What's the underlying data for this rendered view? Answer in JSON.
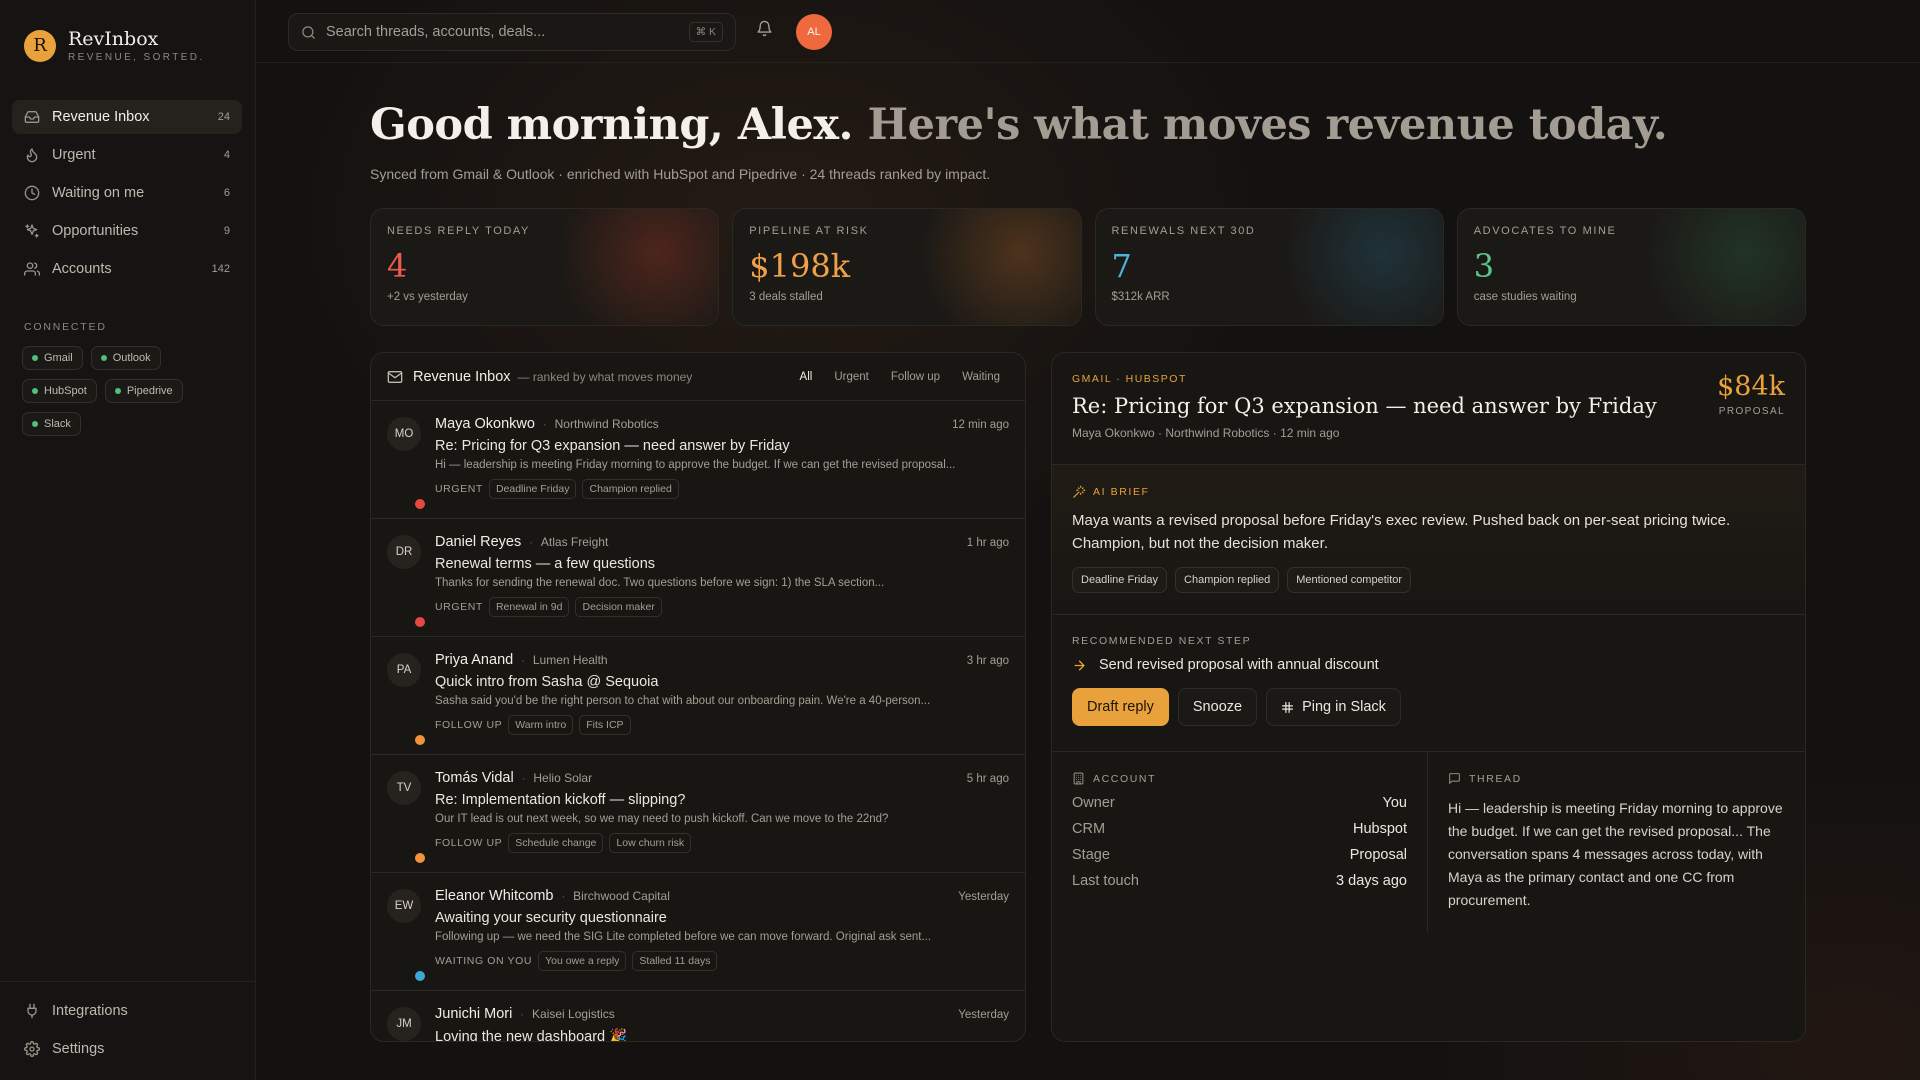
{
  "brand": {
    "logo_letter": "R",
    "name": "RevInbox",
    "tagline": "REVENUE, SORTED."
  },
  "sidebar": {
    "items": [
      {
        "label": "Revenue Inbox",
        "count": "24",
        "icon": "inbox-icon"
      },
      {
        "label": "Urgent",
        "count": "4",
        "icon": "flame-icon"
      },
      {
        "label": "Waiting on me",
        "count": "6",
        "icon": "clock-icon"
      },
      {
        "label": "Opportunities",
        "count": "9",
        "icon": "sparkles-icon"
      },
      {
        "label": "Accounts",
        "count": "142",
        "icon": "users-icon"
      }
    ],
    "connected_title": "CONNECTED",
    "connections": [
      "Gmail",
      "Outlook",
      "HubSpot",
      "Pipedrive",
      "Slack"
    ],
    "bottom": [
      {
        "label": "Integrations",
        "icon": "plug-icon"
      },
      {
        "label": "Settings",
        "icon": "gear-icon"
      }
    ]
  },
  "topbar": {
    "search_placeholder": "Search threads, accounts, deals...",
    "search_shortcut": "⌘ K",
    "avatar_initials": "AL"
  },
  "header": {
    "greeting": "Good morning, Alex.",
    "greeting_muted": "Here's what moves revenue today.",
    "subline": "Synced from Gmail & Outlook · enriched with HubSpot and Pipedrive · 24 threads ranked by impact."
  },
  "stats": [
    {
      "label": "NEEDS REPLY TODAY",
      "value": "4",
      "sub": "+2 vs yesterday",
      "color": "#ef5a4f",
      "glow": "rgba(170,60,40,0.35)"
    },
    {
      "label": "PIPELINE AT RISK",
      "value": "$198k",
      "sub": "3 deals stalled",
      "color": "#f0a048",
      "glow": "rgba(170,100,40,0.35)"
    },
    {
      "label": "RENEWALS NEXT 30D",
      "value": "7",
      "sub": "$312k ARR",
      "color": "#4fb4d8",
      "glow": "rgba(40,110,140,0.30)"
    },
    {
      "label": "ADVOCATES TO MINE",
      "value": "3",
      "sub": "case studies waiting",
      "color": "#5cc48a",
      "glow": "rgba(50,120,80,0.28)"
    }
  ],
  "inbox": {
    "title": "Revenue Inbox",
    "subtitle": "— ranked by what moves money",
    "filters": [
      "All",
      "Urgent",
      "Follow up",
      "Waiting"
    ],
    "threads": [
      {
        "initials": "MO",
        "name": "Maya Okonkwo",
        "company": "Northwind Robotics",
        "time": "12 min ago",
        "subject": "Re: Pricing for Q3 expansion — need answer by Friday",
        "preview": "Hi — leadership is meeting Friday morning to approve the budget. If we can get the revised proposal...",
        "status": "URGENT",
        "tags": [
          "Deadline Friday",
          "Champion replied"
        ],
        "dot": "#e5483f"
      },
      {
        "initials": "DR",
        "name": "Daniel Reyes",
        "company": "Atlas Freight",
        "time": "1 hr ago",
        "subject": "Renewal terms — a few questions",
        "preview": "Thanks for sending the renewal doc. Two questions before we sign: 1) the SLA section...",
        "status": "URGENT",
        "tags": [
          "Renewal in 9d",
          "Decision maker"
        ],
        "dot": "#e5483f"
      },
      {
        "initials": "PA",
        "name": "Priya Anand",
        "company": "Lumen Health",
        "time": "3 hr ago",
        "subject": "Quick intro from Sasha @ Sequoia",
        "preview": "Sasha said you'd be the right person to chat with about our onboarding pain. We're a 40-person...",
        "status": "FOLLOW UP",
        "tags": [
          "Warm intro",
          "Fits ICP"
        ],
        "dot": "#f0923e"
      },
      {
        "initials": "TV",
        "name": "Tomás Vidal",
        "company": "Helio Solar",
        "time": "5 hr ago",
        "subject": "Re: Implementation kickoff — slipping?",
        "preview": "Our IT lead is out next week, so we may need to push kickoff. Can we move to the 22nd?",
        "status": "FOLLOW UP",
        "tags": [
          "Schedule change",
          "Low churn risk"
        ],
        "dot": "#f0923e"
      },
      {
        "initials": "EW",
        "name": "Eleanor Whitcomb",
        "company": "Birchwood Capital",
        "time": "Yesterday",
        "subject": "Awaiting your security questionnaire",
        "preview": "Following up — we need the SIG Lite completed before we can move forward. Original ask sent...",
        "status": "WAITING ON YOU",
        "tags": [
          "You owe a reply",
          "Stalled 11 days"
        ],
        "dot": "#3fa6d6"
      },
      {
        "initials": "JM",
        "name": "Junichi Mori",
        "company": "Kaisei Logistics",
        "time": "Yesterday",
        "subject": "Loving the new dashboard 🎉",
        "preview": "",
        "status": "",
        "tags": [],
        "dot": ""
      }
    ]
  },
  "detail": {
    "source": "GMAIL · HUBSPOT",
    "subject": "Re: Pricing for Q3 expansion — need answer by Friday",
    "meta": "Maya Okonkwo · Northwind Robotics · 12 min ago",
    "amount": "$84k",
    "stage_label": "PROPOSAL",
    "brief_label": "AI BRIEF",
    "brief": "Maya wants a revised proposal before Friday's exec review. Pushed back on per-seat pricing twice. Champion, but not the decision maker.",
    "brief_tags": [
      "Deadline Friday",
      "Champion replied",
      "Mentioned competitor"
    ],
    "next_label": "RECOMMENDED NEXT STEP",
    "next_step": "Send revised proposal with annual discount",
    "actions": {
      "draft": "Draft reply",
      "snooze": "Snooze",
      "slack": "Ping in Slack"
    },
    "account_label": "ACCOUNT",
    "account": [
      {
        "k": "Owner",
        "v": "You"
      },
      {
        "k": "CRM",
        "v": "Hubspot"
      },
      {
        "k": "Stage",
        "v": "Proposal"
      },
      {
        "k": "Last touch",
        "v": "3 days ago"
      }
    ],
    "thread_label": "THREAD",
    "thread_text": "Hi — leadership is meeting Friday morning to approve the budget. If we can get the revised proposal... The conversation spans 4 messages across today, with Maya as the primary contact and one CC from procurement."
  }
}
